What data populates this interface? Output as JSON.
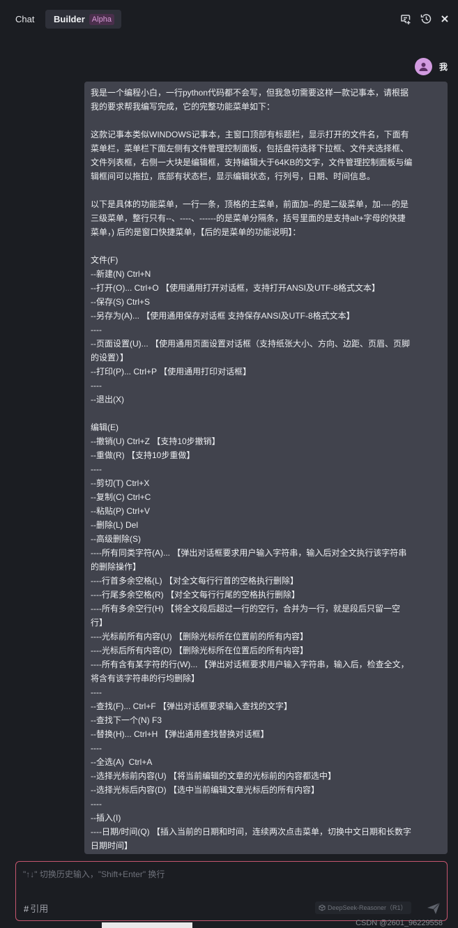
{
  "tabs": {
    "chat": "Chat",
    "builder": "Builder",
    "alpha": "Alpha"
  },
  "toolbar_icons": [
    "new-chat-icon",
    "history-icon",
    "close-icon"
  ],
  "user": {
    "name": "我",
    "avatar_color": "#d29be0"
  },
  "message_lines": [
    "我是一个编程小白，一行python代码都不会写，但我急切需要这样一款记事本，请根据",
    "我的要求帮我编写完成，它的完整功能菜单如下：",
    "",
    "这款记事本类似WINDOWS记事本，主窗口顶部有标题栏，显示打开的文件名，下面有",
    "菜单栏，菜单栏下面左侧有文件管理控制面板，包括盘符选择下拉框、文件夹选择框、",
    "文件列表框，右侧一大块是编辑框，支持编辑大于64KB的文字，文件管理控制面板与编",
    "辑框间可以拖拉，底部有状态栏，显示编辑状态，行列号，日期、时间信息。",
    "",
    "以下是具体的功能菜单，一行一条，顶格的主菜单，前面加--的是二级菜单，加----的是",
    "三级菜单，整行只有--、----、------的是菜单分隔条，括号里面的是支持alt+字母的快捷",
    "菜单，) 后的是窗口快捷菜单，【后的是菜单的功能说明】：",
    "",
    "文件(F)",
    "--新建(N) Ctrl+N",
    "--打开(O)... Ctrl+O 【使用通用打开对话框，支持打开ANSI及UTF-8格式文本】",
    "--保存(S) Ctrl+S",
    "--另存为(A)... 【使用通用保存对话框 支持保存ANSI及UTF-8格式文本】",
    "----",
    "--页面设置(U)... 【使用通用页面设置对话框（支持纸张大小、方向、边距、页眉、页脚",
    "的设置）】",
    "--打印(P)... Ctrl+P 【使用通用打印对话框】",
    "----",
    "--退出(X)",
    "",
    "编辑(E)",
    "--撤销(U) Ctrl+Z 【支持10步撤销】",
    "--重做(R) 【支持10步重做】",
    "----",
    "--剪切(T) Ctrl+X",
    "--复制(C) Ctrl+C",
    "--粘贴(P) Ctrl+V",
    "--删除(L) Del",
    "--高级删除(S)",
    "----所有同类字符(A)... 【弹出对话框要求用户输入字符串，输入后对全文执行该字符串",
    "的删除操作】",
    "----行首多余空格(L) 【对全文每行行首的空格执行删除】",
    "----行尾多余空格(R) 【对全文每行行尾的空格执行删除】",
    "----所有多余空行(H) 【将全文段后超过一行的空行，合并为一行，就是段后只留一空",
    "行】",
    "----光标前所有内容(U) 【删除光标所在位置前的所有内容】",
    "----光标后所有内容(D) 【删除光标所在位置后的所有内容】",
    "----所有含有某字符的行(W)... 【弹出对话框要求用户输入字符串，输入后，检查全文，",
    "将含有该字符串的行均删除】",
    "----",
    "--查找(F)... Ctrl+F 【弹出对话框要求输入查找的文字】",
    "--查找下一个(N) F3",
    "--替换(H)... Ctrl+H 【弹出通用查找替换对话框】",
    "----",
    "--全选(A)  Ctrl+A",
    "--选择光标前内容(U) 【将当前编辑的文章的光标前的内容都选中】",
    "--选择光标后内容(D) 【选中当前编辑文章光标后的所有内容】",
    "----",
    "--插入(I)",
    "----日期/时间(Q) 【插入当前的日期和时间，连续两次点击菜单，切换中文日期和长数字",
    "日期时间】"
  ],
  "composer": {
    "placeholder": "\"↑↓\" 切换历史输入，\"Shift+Enter\" 换行",
    "reference_label": "引用",
    "model": "DeepSeek-Reasoner（R1）"
  },
  "watermark": "CSDN @2601_96229558",
  "colors": {
    "background": "#1b1d22",
    "bubble": "#41434d",
    "accent_border": "#c7566f",
    "alpha_text": "#d699d6"
  }
}
